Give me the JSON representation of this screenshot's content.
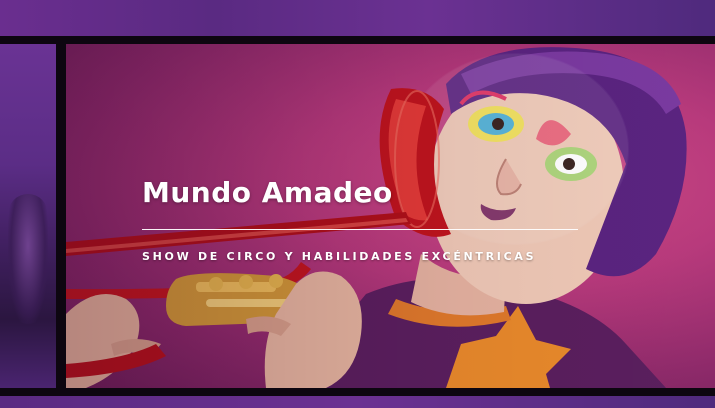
{
  "hero": {
    "title": "Mundo Amadeo",
    "subtitle": "SHOW DE CIRCO Y HABILIDADES EXCÉNTRICAS",
    "image_alt": "performer-with-trumpet-photo"
  },
  "colors": {
    "frame": "#0d0610",
    "purple": "#5b2a86",
    "magenta_bg": "#b83a7c",
    "text": "#ffffff"
  }
}
